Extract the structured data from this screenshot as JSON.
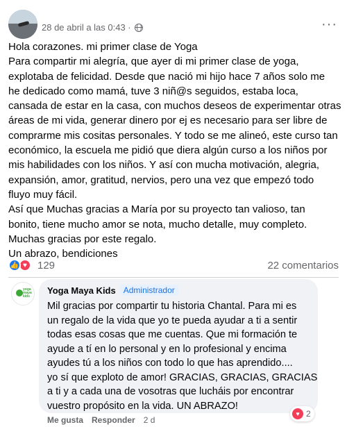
{
  "post": {
    "timestamp": "28 de abril a las 0:43 ·",
    "more_label": "···",
    "body_lines": [
      "Hola corazones. mi primer clase de Yoga",
      "Para compartir mi alegría, que ayer di mi primer clase de yoga,",
      "explotaba de felicidad. Desde que nació mi hijo hace 7 años solo me",
      "he dedicado como mamá, tuve 3 niñ@s seguidos, estaba loca,",
      "cansada de estar en la casa, con muchos deseos de experimentar otras",
      "áreas de mi vida, generar dinero por ej es necesario para ser libre de",
      "comprarme mis cositas personales. Y todo se me alineó, este curso tan",
      "económico, la escuela me pidió que diera algún curso a los niños por",
      "mis habilidades con los niños. Y así con mucha motivación, alegria,",
      "expansión, amor, gratitud, nervios, pero una vez que empezó todo",
      "fluyo muy fácil.",
      "Así que Muchas gracias a María por su proyecto tan valioso, tan",
      "bonito, tiene mucho amor se nota, mucho detalle, muy completo.",
      "Muchas gracias por este regalo.",
      "Un abrazo, bendiciones"
    ]
  },
  "reactions": {
    "count": "129",
    "comments": "22 comentarios",
    "like_glyph": "👍",
    "love_glyph": "♥"
  },
  "comment": {
    "author": "Yoga Maya Kids",
    "badge": "Administrador",
    "logo_text": "yoga maya kids",
    "lines": [
      "Mil gracias por compartir tu historia Chantal. Para mi es",
      "un regalo de la vida que yo te pueda ayudar a ti a sentir",
      "todas esas cosas que me cuentas. Que mi formación te",
      "ayude a tí en lo personal y en lo profesional y encima",
      "ayudes tú a los niños con todo lo que has aprendido....",
      "yo sí que exploto de amor! GRACIAS, GRACIAS, GRACIAS",
      "a ti y a cada una de vosotras que lucháis por encontrar",
      "vuestro propósito en la vida. UN ABRAZO!"
    ],
    "actions": {
      "like": "Me gusta",
      "reply": "Responder",
      "time": "2 d"
    },
    "reaction_count": "2",
    "reaction_glyph": "♥"
  },
  "colors": {
    "accent": "#1877f2",
    "love": "#f33e58",
    "muted": "#65676b",
    "bubble": "#f0f2f5",
    "brand_green": "#3aa935"
  }
}
